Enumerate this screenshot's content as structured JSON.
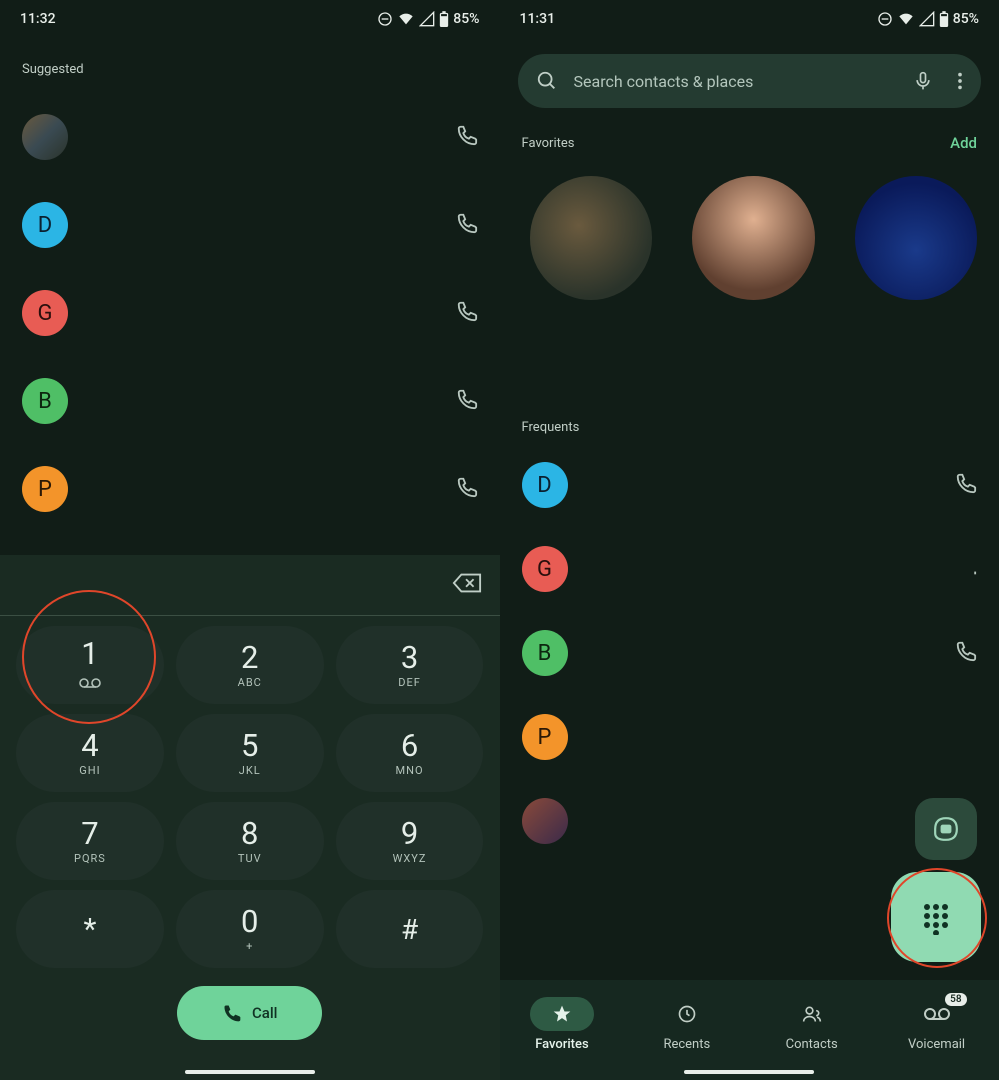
{
  "left": {
    "status": {
      "time": "11:32",
      "battery": "85%"
    },
    "suggested_label": "Suggested",
    "suggested": [
      {
        "type": "photo"
      },
      {
        "letter": "D",
        "cls": "avatar-d"
      },
      {
        "letter": "G",
        "cls": "avatar-g"
      },
      {
        "letter": "B",
        "cls": "avatar-b"
      },
      {
        "letter": "P",
        "cls": "avatar-p"
      }
    ],
    "keys": [
      {
        "num": "1",
        "sub": "",
        "vm": true
      },
      {
        "num": "2",
        "sub": "ABC"
      },
      {
        "num": "3",
        "sub": "DEF"
      },
      {
        "num": "4",
        "sub": "GHI"
      },
      {
        "num": "5",
        "sub": "JKL"
      },
      {
        "num": "6",
        "sub": "MNO"
      },
      {
        "num": "7",
        "sub": "PQRS"
      },
      {
        "num": "8",
        "sub": "TUV"
      },
      {
        "num": "9",
        "sub": "WXYZ"
      },
      {
        "num": "*",
        "sub": "",
        "special": "star"
      },
      {
        "num": "0",
        "sub": "+"
      },
      {
        "num": "#",
        "sub": "",
        "special": "hash"
      }
    ],
    "call_label": "Call"
  },
  "right": {
    "status": {
      "time": "11:31",
      "battery": "85%"
    },
    "search_placeholder": "Search contacts & places",
    "favorites_label": "Favorites",
    "add_label": "Add",
    "frequents_label": "Frequents",
    "frequents": [
      {
        "letter": "D",
        "cls": "avatar-d"
      },
      {
        "letter": "G",
        "cls": "avatar-g"
      },
      {
        "letter": "B",
        "cls": "avatar-b"
      },
      {
        "letter": "P",
        "cls": "avatar-p"
      },
      {
        "type": "photo"
      }
    ],
    "nav": {
      "favorites": "Favorites",
      "recents": "Recents",
      "contacts": "Contacts",
      "voicemail": "Voicemail",
      "vm_count": "58"
    }
  }
}
